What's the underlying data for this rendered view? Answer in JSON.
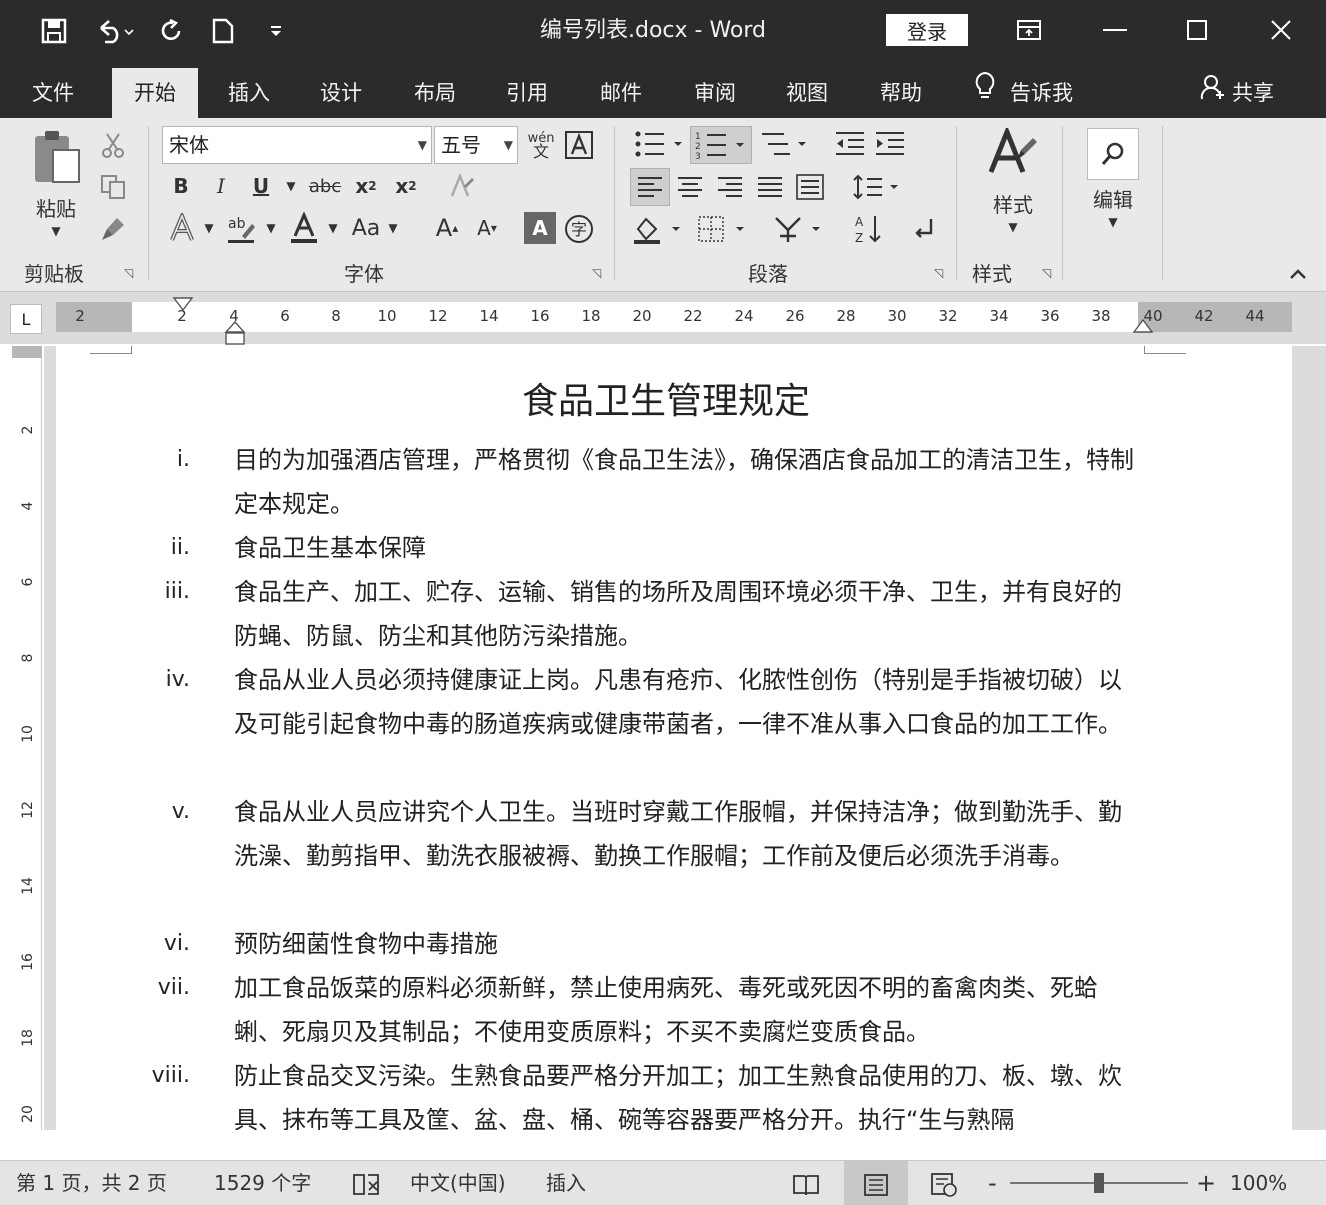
{
  "titlebar": {
    "doc_title": "编号列表.docx  -  Word",
    "login_label": "登录",
    "quick_access": [
      "save-icon",
      "undo-icon",
      "redo-icon",
      "new-doc-icon",
      "customize-icon"
    ]
  },
  "menu": {
    "tabs": [
      "文件",
      "开始",
      "插入",
      "设计",
      "布局",
      "引用",
      "邮件",
      "审阅",
      "视图",
      "帮助"
    ],
    "tell_me": "告诉我",
    "share": "共享"
  },
  "ribbon": {
    "clipboard": {
      "paste_label": "粘贴",
      "group_label": "剪贴板"
    },
    "font": {
      "font_name": "宋体",
      "font_size": "五号",
      "group_label": "字体"
    },
    "paragraph": {
      "group_label": "段落"
    },
    "styles": {
      "styles_label": "样式",
      "group_label": "样式"
    },
    "editing": {
      "edit_label": "编辑"
    }
  },
  "ruler": {
    "corner": "L",
    "numbers": [
      "2",
      "2",
      "4",
      "6",
      "8",
      "10",
      "12",
      "14",
      "16",
      "18",
      "20",
      "22",
      "24",
      "26",
      "28",
      "30",
      "32",
      "34",
      "36",
      "38",
      "40",
      "42",
      "44"
    ],
    "vnumbers": [
      "2",
      "4",
      "6",
      "8",
      "10",
      "12",
      "14",
      "16",
      "18",
      "20"
    ]
  },
  "document": {
    "heading": "食品卫生管理规定",
    "items": [
      {
        "num": "i.",
        "text": "目的为加强酒店管理，严格贯彻《食品卫生法》，确保酒店食品加工的清洁卫生，特制定本规定。"
      },
      {
        "num": "ii.",
        "text": "食品卫生基本保障"
      },
      {
        "num": "iii.",
        "text": "食品生产、加工、贮存、运输、销售的场所及周围环境必须干净、卫生，并有良好的防蝇、防鼠、防尘和其他防污染措施。"
      },
      {
        "num": "iv.",
        "text": "食品从业人员必须持健康证上岗。凡患有疮疖、化脓性创伤（特别是手指被切破）以及可能引起食物中毒的肠道疾病或健康带菌者，一律不准从事入口食品的加工工作。"
      },
      {
        "num": "v.",
        "text": "食品从业人员应讲究个人卫生。当班时穿戴工作服帽，并保持洁净；做到勤洗手、勤洗澡、勤剪指甲、勤洗衣服被褥、勤换工作服帽；工作前及便后必须洗手消毒。"
      },
      {
        "num": "vi.",
        "text": "预防细菌性食物中毒措施"
      },
      {
        "num": "vii.",
        "text": "加工食品饭菜的原料必须新鲜，禁止使用病死、毒死或死因不明的畜禽肉类、死蛤蜊、死扇贝及其制品；不使用变质原料；不买不卖腐烂变质食品。"
      },
      {
        "num": "viii.",
        "text": "防止食品交叉污染。生熟食品要严格分开加工；加工生熟食品使用的刀、板、墩、炊具、抹布等工具及筐、盆、盘、桶、碗等容器要严格分开。执行“生与熟隔"
      }
    ]
  },
  "status": {
    "page": "第 1 页，共 2 页",
    "words": "1529 个字",
    "language": "中文(中国)",
    "mode": "插入",
    "zoom_minus": "-",
    "zoom_plus": "+",
    "zoom": "100%",
    "zoom_level_percent": 100
  }
}
